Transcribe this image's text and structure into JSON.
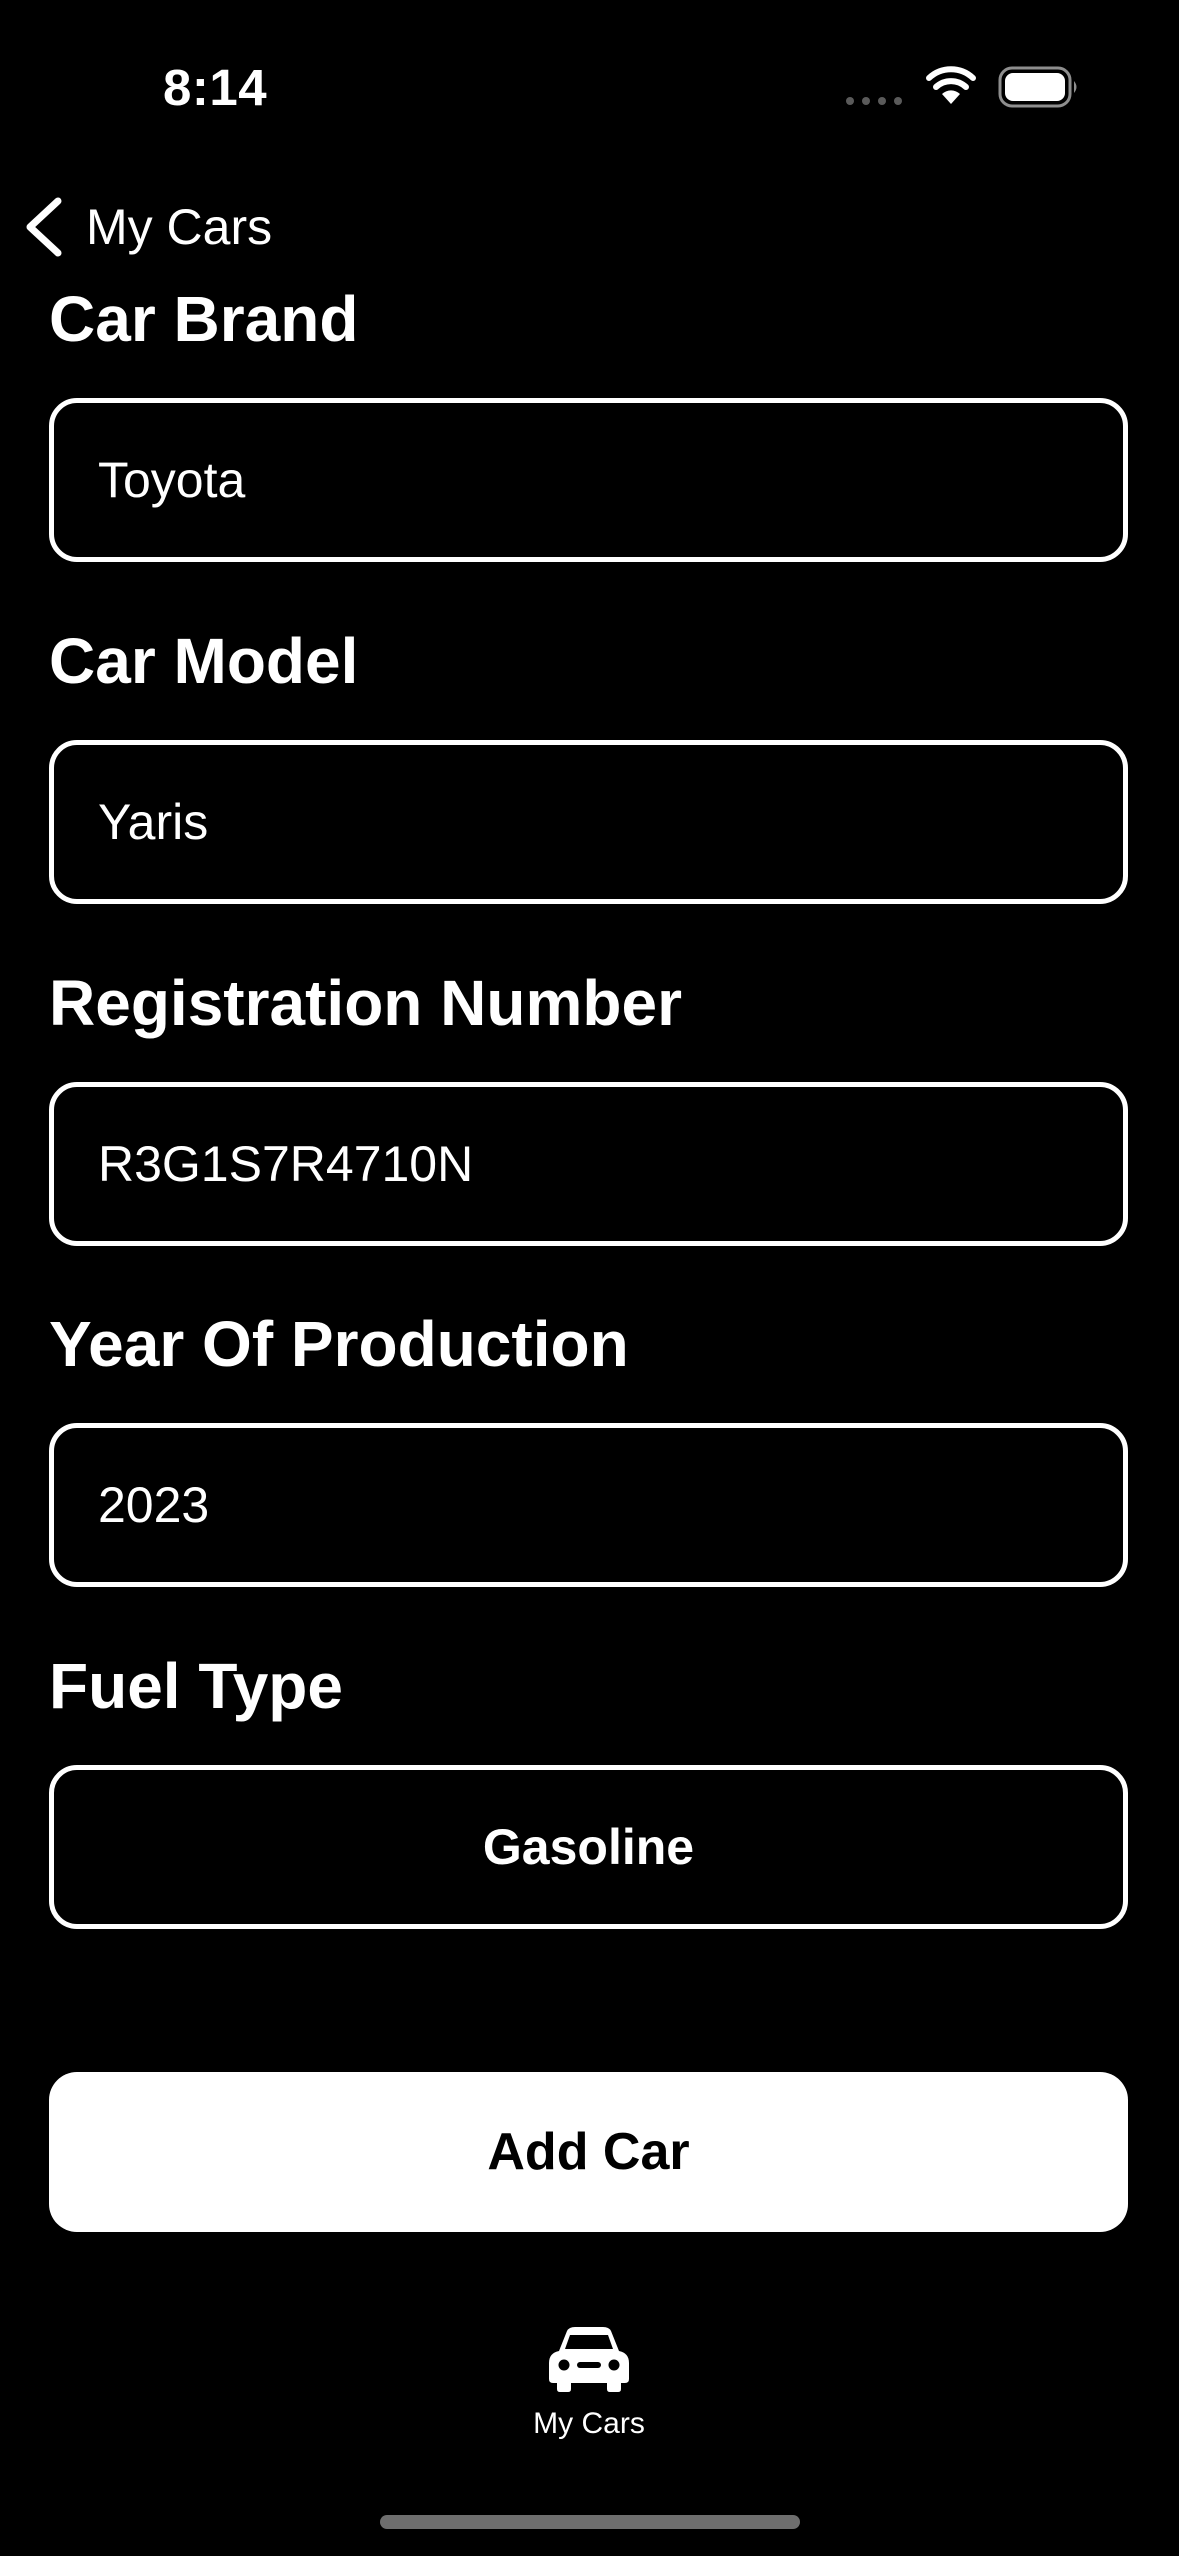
{
  "status_bar": {
    "time": "8:14"
  },
  "nav": {
    "back_label": "My Cars"
  },
  "form": {
    "fields": [
      {
        "label": "Car Brand",
        "value": "Toyota"
      },
      {
        "label": "Car Model",
        "value": "Yaris"
      },
      {
        "label": "Registration Number",
        "value": "R3G1S7R4710N"
      },
      {
        "label": "Year Of Production",
        "value": "2023"
      }
    ],
    "fuel": {
      "label": "Fuel Type",
      "value": "Gasoline"
    }
  },
  "actions": {
    "add_label": "Add Car"
  },
  "tab_bar": {
    "items": [
      {
        "label": "My Cars",
        "icon": "car-icon"
      }
    ]
  },
  "colors": {
    "background": "#000000",
    "foreground": "#ffffff",
    "home_indicator": "#6e6e6e"
  }
}
